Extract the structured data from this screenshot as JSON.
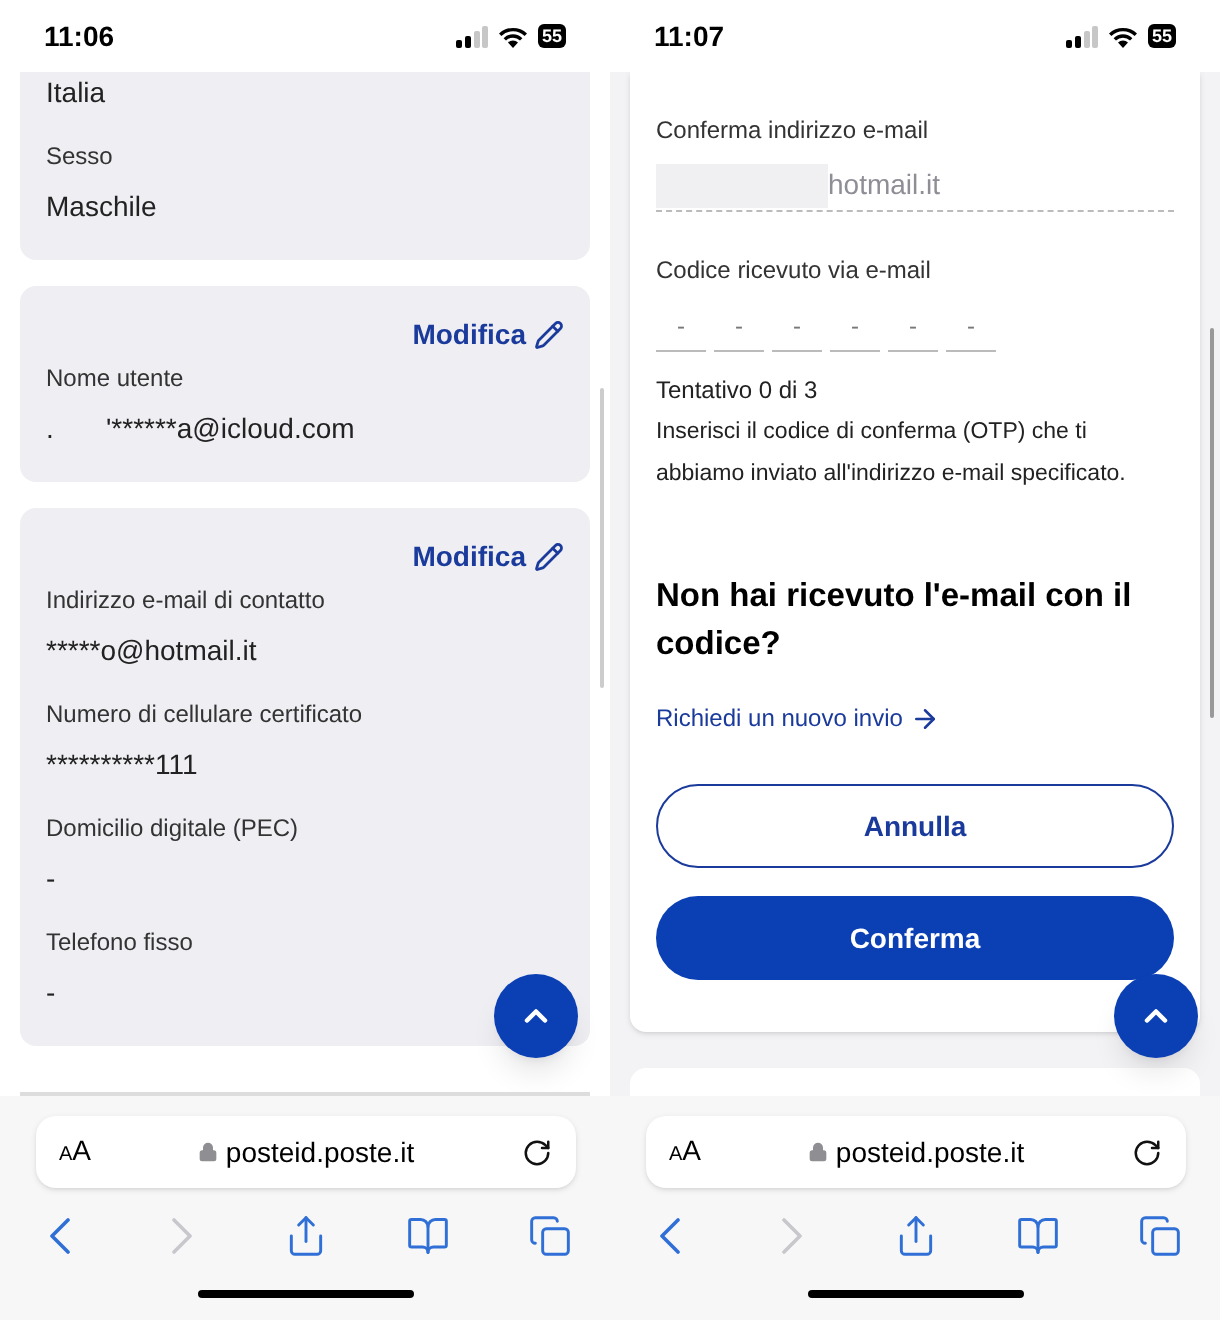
{
  "screens": [
    {
      "status_bar": {
        "time": "11:06",
        "battery": "55"
      },
      "kind": "profile",
      "cards": [
        {
          "fields": [
            {
              "value": "Italia"
            },
            {
              "label": "Sesso",
              "value": "Maschile"
            }
          ]
        },
        {
          "action": "Modifica",
          "fields": [
            {
              "label": "Nome utente",
              "prefix": ".",
              "value": "'******a@icloud.com"
            }
          ]
        },
        {
          "action": "Modifica",
          "fields": [
            {
              "label": "Indirizzo e-mail di contatto",
              "value": "*****o@hotmail.it"
            },
            {
              "label": "Numero di cellulare certificato",
              "value": "**********111"
            },
            {
              "label": "Domicilio digitale (PEC)",
              "value": "-"
            },
            {
              "label": "Telefono fisso",
              "value": "-"
            }
          ]
        }
      ],
      "browser": {
        "text_size": "AA",
        "url": "posteid.poste.it",
        "toolbar": [
          {
            "kind": "back",
            "disabled": false
          },
          {
            "kind": "forward",
            "disabled": true
          },
          {
            "kind": "share",
            "disabled": false
          },
          {
            "kind": "bookmarks",
            "disabled": false
          },
          {
            "kind": "tabs",
            "disabled": false
          }
        ]
      }
    },
    {
      "status_bar": {
        "time": "11:07",
        "battery": "55"
      },
      "kind": "verify",
      "email_field": {
        "label": "Conferma indirizzo e-mail",
        "value": "hotmail.it"
      },
      "code_field": {
        "label": "Codice ricevuto via e-mail",
        "digits": [
          "-",
          "-",
          "-",
          "-",
          "-",
          "-"
        ]
      },
      "attempts": "Tentativo 0 di 3",
      "help": "Inserisci il codice di conferma (OTP) che ti abbiamo inviato all'indirizzo e-mail specificato.",
      "heading": "Non hai ricevuto l'e-mail con il codice?",
      "resend_link": "Richiedi un nuovo invio",
      "buttons": [
        {
          "label": "Annulla",
          "kind": "outline"
        },
        {
          "label": "Conferma",
          "kind": "primary"
        }
      ],
      "browser": {
        "text_size": "AA",
        "url": "posteid.poste.it",
        "toolbar": [
          {
            "kind": "back",
            "disabled": false
          },
          {
            "kind": "forward",
            "disabled": true
          },
          {
            "kind": "share",
            "disabled": false
          },
          {
            "kind": "bookmarks",
            "disabled": false
          },
          {
            "kind": "tabs",
            "disabled": false
          }
        ]
      }
    }
  ]
}
